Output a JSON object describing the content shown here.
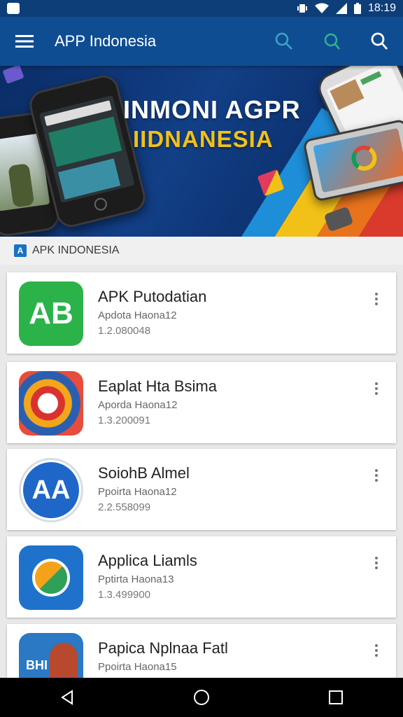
{
  "status_bar": {
    "time": "18:19"
  },
  "app_bar": {
    "title": "APP Indonesia"
  },
  "banner": {
    "headline": "INMONI AGPR",
    "subline": "IIDNANESIA"
  },
  "section": {
    "logo": "A",
    "title": "APK INDONESIA"
  },
  "apps": [
    {
      "name": "APK Putodatian",
      "developer": "Apdota Haona12",
      "version": "1.2.080048",
      "icon_text": "AB"
    },
    {
      "name": "Eaplat Hta Bsima",
      "developer": "Aporda Haona12",
      "version": "1.3.200091",
      "icon_text": ""
    },
    {
      "name": "SoiohB Almel",
      "developer": "Ppoirta Haona12",
      "version": "2.2.558099",
      "icon_text": "AA"
    },
    {
      "name": "Applica Liamls",
      "developer": "Pptirta Haona13",
      "version": "1.3.499900",
      "icon_text": ""
    },
    {
      "name": "Papica Nplnaa Fatl",
      "developer": "Ppoirta Haona15",
      "version": "",
      "icon_text": "BHI"
    }
  ],
  "colors": {
    "app_bar": "#0f4d92",
    "status_bar": "#0d3e78",
    "accent_yellow": "#f2c118"
  },
  "icons": [
    "menu-icon",
    "search-icon",
    "search-icon",
    "search-icon",
    "more-vert-icon",
    "back-icon",
    "home-icon",
    "recents-icon"
  ]
}
